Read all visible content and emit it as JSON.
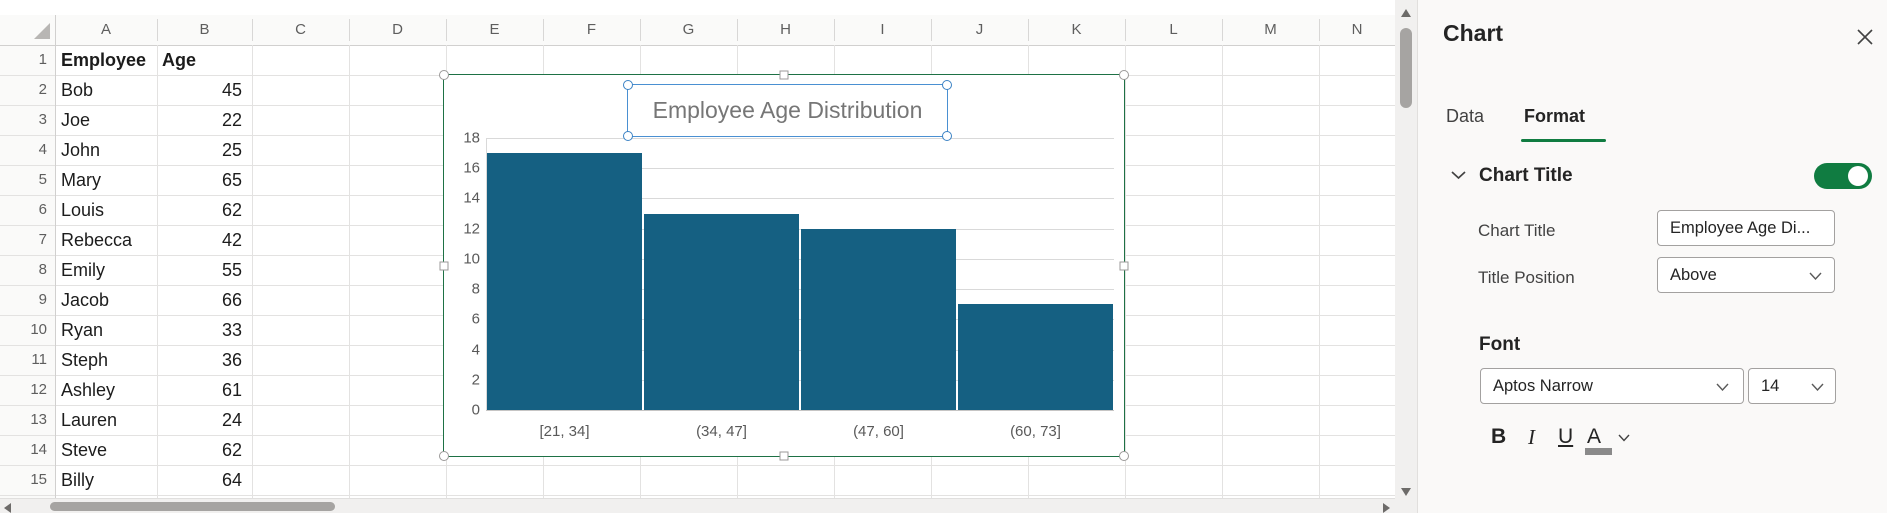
{
  "sheet": {
    "columns": [
      "A",
      "B",
      "C",
      "D",
      "E",
      "F",
      "G",
      "H",
      "I",
      "J",
      "K",
      "L",
      "M",
      "N"
    ],
    "rows": [
      {
        "n": "1",
        "employee": "Employee",
        "age": "Age",
        "bold": true
      },
      {
        "n": "2",
        "employee": "Bob",
        "age": "45"
      },
      {
        "n": "3",
        "employee": "Joe",
        "age": "22"
      },
      {
        "n": "4",
        "employee": "John",
        "age": "25"
      },
      {
        "n": "5",
        "employee": "Mary",
        "age": "65"
      },
      {
        "n": "6",
        "employee": "Louis",
        "age": "62"
      },
      {
        "n": "7",
        "employee": "Rebecca",
        "age": "42"
      },
      {
        "n": "8",
        "employee": "Emily",
        "age": "55"
      },
      {
        "n": "9",
        "employee": "Jacob",
        "age": "66"
      },
      {
        "n": "10",
        "employee": "Ryan",
        "age": "33"
      },
      {
        "n": "11",
        "employee": "Steph",
        "age": "36"
      },
      {
        "n": "12",
        "employee": "Ashley",
        "age": "61"
      },
      {
        "n": "13",
        "employee": "Lauren",
        "age": "24"
      },
      {
        "n": "14",
        "employee": "Steve",
        "age": "62"
      },
      {
        "n": "15",
        "employee": "Billy",
        "age": "64"
      }
    ]
  },
  "chart_data": {
    "type": "bar",
    "kind": "histogram",
    "title": "Employee Age Distribution",
    "categories": [
      "[21, 34]",
      "(34, 47]",
      "(47, 60]",
      "(60, 73]"
    ],
    "values": [
      17,
      13,
      12,
      7
    ],
    "xlabel": "",
    "ylabel": "",
    "ylim": [
      0,
      18
    ],
    "yticks": [
      0,
      2,
      4,
      6,
      8,
      10,
      12,
      14,
      16,
      18
    ],
    "grid": true,
    "legend": "none",
    "bar_color": "#156082",
    "title_color": "#767676",
    "selected": true
  },
  "panel": {
    "title": "Chart",
    "tabs": {
      "data": "Data",
      "format": "Format",
      "active": "Format"
    },
    "chart_title_section": {
      "header": "Chart Title",
      "toggle_on": true,
      "title_field_label": "Chart Title",
      "title_field_value": "Employee Age Di...",
      "position_field_label": "Title Position",
      "position_field_value": "Above"
    },
    "font_section": {
      "header": "Font",
      "family_value": "Aptos Narrow",
      "size_value": "14",
      "bold_label": "B",
      "italic_label": "I",
      "underline_label": "U",
      "font_color_label": "A"
    },
    "accent_green": "#107C41"
  },
  "colors": {
    "bar": "#156082",
    "chart_border": "#1e7145",
    "selection_blue": "#4a90d2",
    "accent_green": "#107C41"
  }
}
